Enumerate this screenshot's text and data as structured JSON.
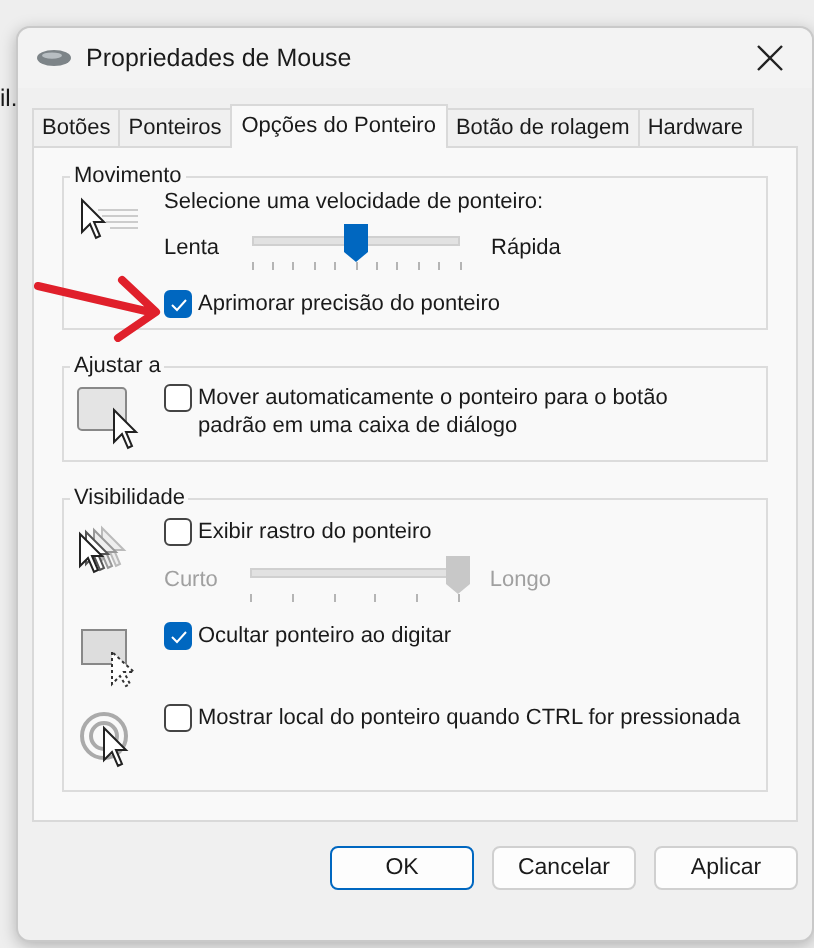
{
  "background_text": "il.",
  "window": {
    "title": "Propriedades de Mouse"
  },
  "tabs": [
    {
      "label": "Botões",
      "selected": false
    },
    {
      "label": "Ponteiros",
      "selected": false
    },
    {
      "label": "Opções do Ponteiro",
      "selected": true
    },
    {
      "label": "Botão de rolagem",
      "selected": false
    },
    {
      "label": "Hardware",
      "selected": false
    }
  ],
  "groups": [
    {
      "title": "Movimento",
      "kind": "motion",
      "prompt": "Selecione uma velocidade de ponteiro:",
      "slider": {
        "min_label": "Lenta",
        "max_label": "Rápida",
        "level": 0.5,
        "disabled": false
      },
      "options": [
        {
          "label": "Aprimorar precisão do ponteiro",
          "checked": true
        }
      ]
    },
    {
      "title": "Ajustar a",
      "kind": "snap",
      "options": [
        {
          "label": "Mover automaticamente o ponteiro para o botão padrão em uma caixa de diálogo",
          "checked": false
        }
      ]
    },
    {
      "title": "Visibilidade",
      "kind": "visibility",
      "options": [
        {
          "label": "Exibir rastro do ponteiro",
          "checked": false,
          "kind": "trail",
          "slider": {
            "min_label": "Curto",
            "max_label": "Longo",
            "level": 1,
            "disabled": true
          }
        },
        {
          "label": "Ocultar ponteiro ao digitar",
          "checked": true,
          "kind": "hide"
        },
        {
          "label": "Mostrar local do ponteiro quando CTRL for pressionada",
          "checked": false,
          "kind": "locate"
        }
      ]
    }
  ],
  "buttons": [
    {
      "label": "OK",
      "default": true
    },
    {
      "label": "Cancelar",
      "default": false
    },
    {
      "label": "Aplicar",
      "default": false
    }
  ],
  "annotations": [
    {
      "kind": "arrow"
    }
  ]
}
